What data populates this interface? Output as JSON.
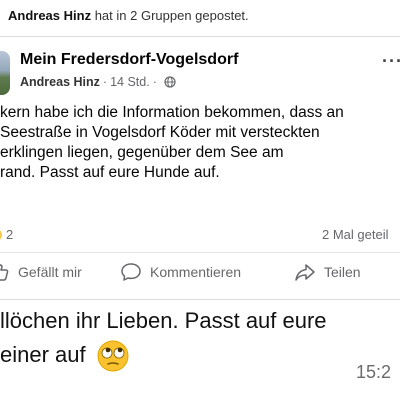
{
  "header": {
    "author": "Andreas Hinz",
    "note": "hat in 2 Gruppen gepostet."
  },
  "post": {
    "group_name": "Mein Fredersdorf-Vogelsdorf",
    "author": "Andreas Hinz",
    "separator": "·",
    "time": "14 Std.",
    "privacy_icon": "globe-icon",
    "more_icon": "more-options-icon",
    "more_label": "···",
    "lines": [
      "kern habe ich die Information bekommen, dass an",
      "Seestraße in Vogelsdorf Köder mit versteckten",
      "erklingen liegen, gegenüber dem See am",
      "rand. Passt auf eure Hunde auf."
    ],
    "reaction_count": "2",
    "shares": "2 Mal geteil"
  },
  "actions": {
    "like": "Gefällt mir",
    "comment": "Kommentieren",
    "share": "Teilen"
  },
  "message": {
    "line1": "llöchen ihr Lieben. Passt auf eure",
    "line2": "einer auf",
    "emoji": "eye-roll-emoji",
    "time": "15:2"
  }
}
